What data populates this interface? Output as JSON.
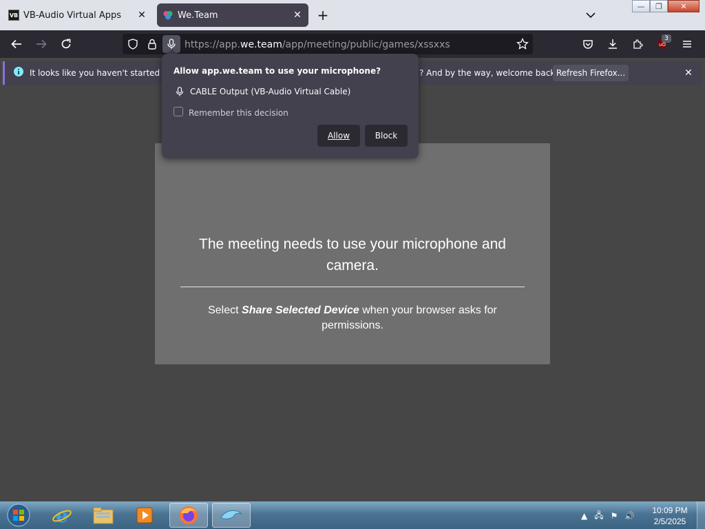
{
  "tabs": [
    {
      "title": "VB-Audio Virtual Apps",
      "favicon_text": "VB"
    },
    {
      "title": "We.Team"
    }
  ],
  "urlbar": {
    "prefix": "https://app.",
    "domain": "we.team",
    "path": "/app/meeting/public/games/xssxxs"
  },
  "extensions": {
    "badge_count": "3"
  },
  "notification": {
    "text_left": "It looks like you haven't started Firefo",
    "text_right": "? And by the way, welcome back!",
    "refresh_label": "Refresh Firefox..."
  },
  "permission_popup": {
    "title": "Allow app.we.team to use your microphone?",
    "device": "CABLE Output (VB-Audio Virtual Cable)",
    "remember_label": "Remember this decision",
    "allow_label": "Allow",
    "block_label": "Block"
  },
  "page": {
    "title": "The meeting needs to use your microphone and camera.",
    "instr_before": "Select ",
    "instr_emphasis": "Share Selected Device",
    "instr_after": " when your browser asks for permissions."
  },
  "taskbar": {
    "time": "10:09 PM",
    "date": "2/5/2025"
  },
  "colors": {
    "accent_notification": "#8f6fde",
    "chrome_dark": "#2b2a33",
    "page_background": "#464646",
    "card_background": "#6f6f6f"
  }
}
